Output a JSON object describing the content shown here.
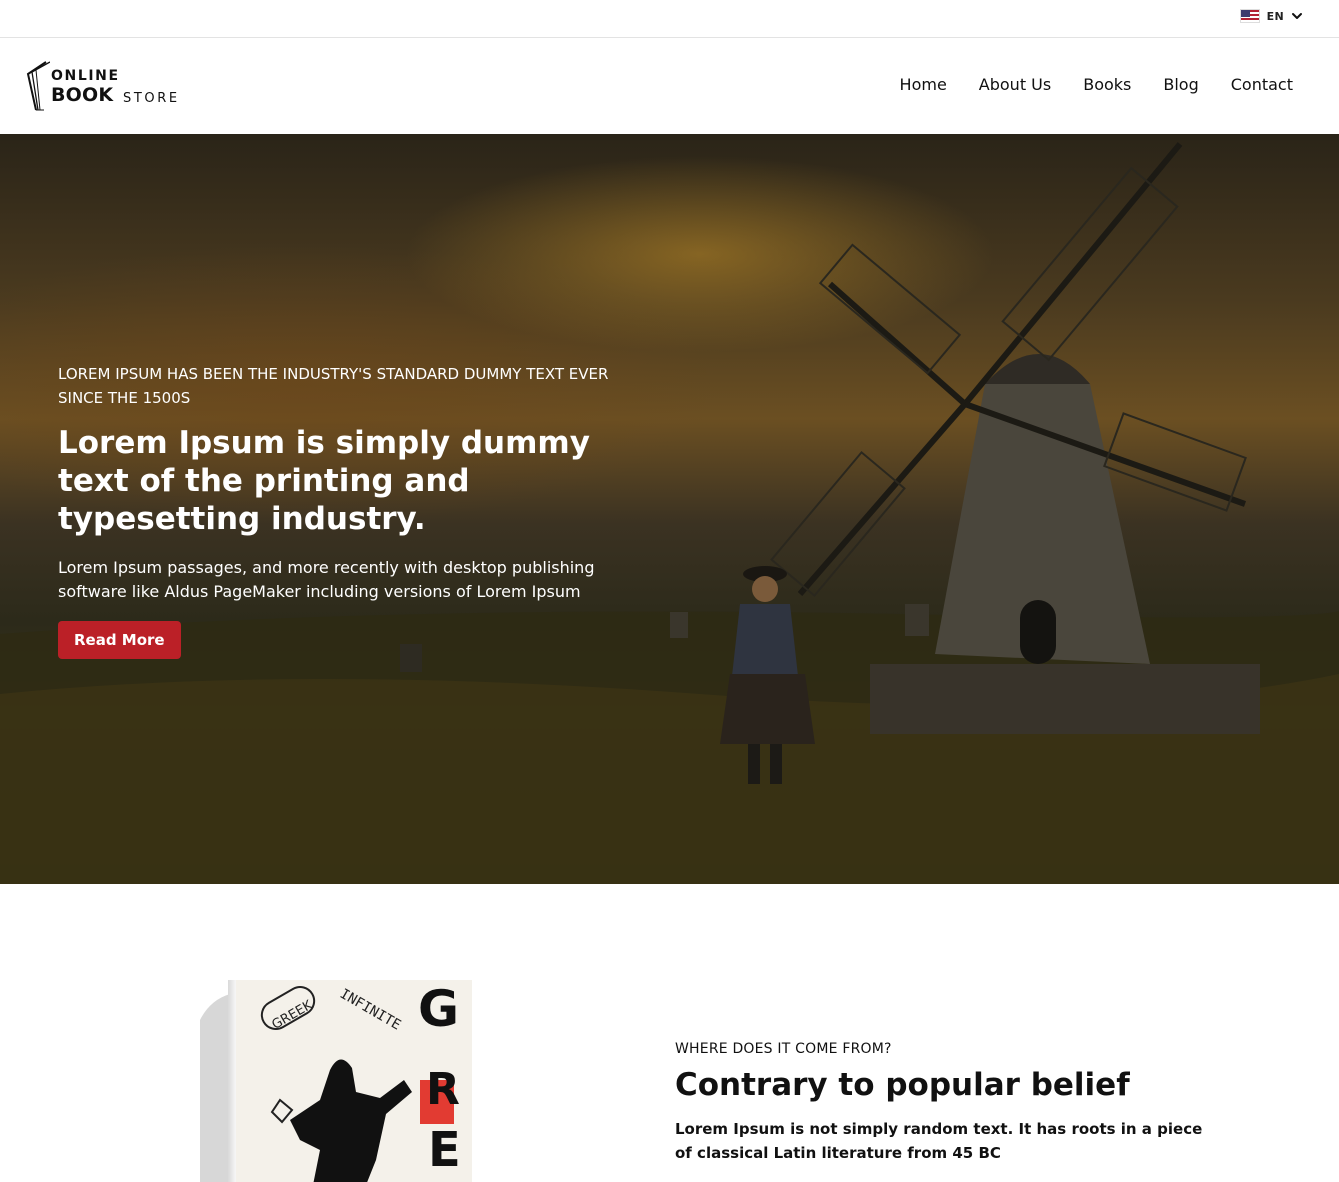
{
  "topbar": {
    "language": {
      "code": "EN",
      "flag_icon": "us-flag-icon"
    }
  },
  "header": {
    "logo": {
      "line1": "ONLINE",
      "line2": "BOOK",
      "line3": "STORE"
    },
    "nav": [
      {
        "label": "Home"
      },
      {
        "label": "About Us"
      },
      {
        "label": "Books"
      },
      {
        "label": "Blog"
      },
      {
        "label": "Contact"
      }
    ]
  },
  "hero": {
    "eyebrow": "LOREM IPSUM HAS BEEN THE INDUSTRY'S STANDARD DUMMY TEXT EVER SINCE THE 1500S",
    "headline": "Lorem Ipsum is simply dummy text of the printing and typesetting industry.",
    "lead": "Lorem Ipsum passages, and more recently with desktop publishing software like Aldus PageMaker including versions of Lorem Ipsum",
    "button": "Read More",
    "button_color": "#bb2027"
  },
  "about": {
    "eyebrow": "WHERE DOES IT COME FROM?",
    "title": "Contrary to popular belief",
    "body": "Lorem Ipsum is not simply random text. It has roots in a piece of classical Latin literature from 45 BC",
    "book_cover": {
      "stamp": "GREEK",
      "subtitle": "INFINITE",
      "letters": [
        "G",
        "R",
        "E"
      ]
    }
  }
}
